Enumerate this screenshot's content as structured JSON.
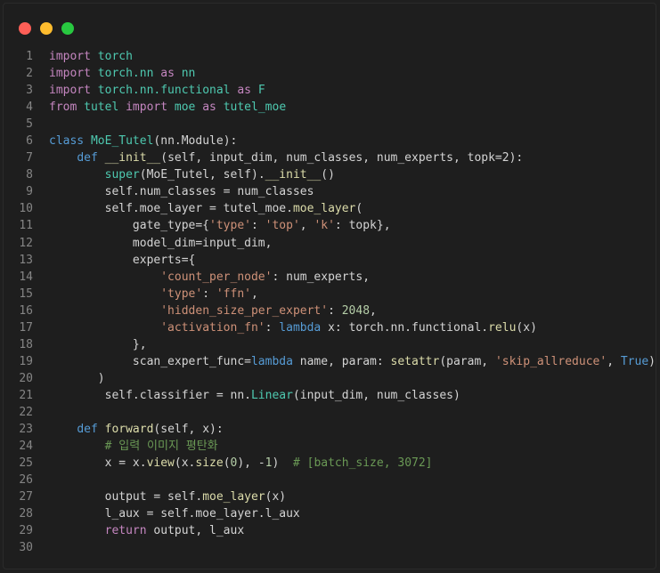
{
  "window": {
    "controls": {
      "close_color": "#ff5f57",
      "minimize_color": "#febc2e",
      "maximize_color": "#28c840"
    }
  },
  "code": {
    "language": "python",
    "lines": [
      [
        {
          "t": "import",
          "c": "ctl"
        },
        {
          "t": " torch",
          "c": "ty"
        }
      ],
      [
        {
          "t": "import",
          "c": "ctl"
        },
        {
          "t": " torch.nn ",
          "c": "ty"
        },
        {
          "t": "as",
          "c": "ctl"
        },
        {
          "t": " nn",
          "c": "ty"
        }
      ],
      [
        {
          "t": "import",
          "c": "ctl"
        },
        {
          "t": " torch.nn.functional ",
          "c": "ty"
        },
        {
          "t": "as",
          "c": "ctl"
        },
        {
          "t": " F",
          "c": "ty"
        }
      ],
      [
        {
          "t": "from",
          "c": "ctl"
        },
        {
          "t": " tutel ",
          "c": "ty"
        },
        {
          "t": "import",
          "c": "ctl"
        },
        {
          "t": " moe ",
          "c": "ty"
        },
        {
          "t": "as",
          "c": "ctl"
        },
        {
          "t": " tutel_moe",
          "c": "ty"
        }
      ],
      [],
      [
        {
          "t": "class",
          "c": "kw"
        },
        {
          "t": " MoE_Tutel",
          "c": "ty"
        },
        {
          "t": "(nn.Module):",
          "c": ""
        }
      ],
      [
        {
          "t": "    "
        },
        {
          "t": "def",
          "c": "kw"
        },
        {
          "t": " __init__",
          "c": "fn"
        },
        {
          "t": "(self, input_dim, num_classes, num_experts, topk=2):",
          "c": ""
        }
      ],
      [
        {
          "t": "        "
        },
        {
          "t": "super",
          "c": "ty"
        },
        {
          "t": "(MoE_Tutel, self).",
          "c": ""
        },
        {
          "t": "__init__",
          "c": "fn"
        },
        {
          "t": "()",
          "c": ""
        }
      ],
      [
        {
          "t": "        self.num_classes = num_classes",
          "c": ""
        }
      ],
      [
        {
          "t": "        self.moe_layer = tutel_moe.",
          "c": ""
        },
        {
          "t": "moe_layer",
          "c": "fn"
        },
        {
          "t": "(",
          "c": ""
        }
      ],
      [
        {
          "t": "            gate_type={",
          "c": ""
        },
        {
          "t": "'type'",
          "c": "st"
        },
        {
          "t": ": ",
          "c": ""
        },
        {
          "t": "'top'",
          "c": "st"
        },
        {
          "t": ", ",
          "c": ""
        },
        {
          "t": "'k'",
          "c": "st"
        },
        {
          "t": ": topk},",
          "c": ""
        }
      ],
      [
        {
          "t": "            model_dim=input_dim,",
          "c": ""
        }
      ],
      [
        {
          "t": "            experts={",
          "c": ""
        }
      ],
      [
        {
          "t": "                "
        },
        {
          "t": "'count_per_node'",
          "c": "st"
        },
        {
          "t": ": num_experts,",
          "c": ""
        }
      ],
      [
        {
          "t": "                "
        },
        {
          "t": "'type'",
          "c": "st"
        },
        {
          "t": ": ",
          "c": ""
        },
        {
          "t": "'ffn'",
          "c": "st"
        },
        {
          "t": ",",
          "c": ""
        }
      ],
      [
        {
          "t": "                "
        },
        {
          "t": "'hidden_size_per_expert'",
          "c": "st"
        },
        {
          "t": ": ",
          "c": ""
        },
        {
          "t": "2048",
          "c": "nu"
        },
        {
          "t": ",",
          "c": ""
        }
      ],
      [
        {
          "t": "                "
        },
        {
          "t": "'activation_fn'",
          "c": "st"
        },
        {
          "t": ": ",
          "c": ""
        },
        {
          "t": "lambda",
          "c": "kw"
        },
        {
          "t": " x: torch.nn.functional.",
          "c": ""
        },
        {
          "t": "relu",
          "c": "fn"
        },
        {
          "t": "(x)",
          "c": ""
        }
      ],
      [
        {
          "t": "            },",
          "c": ""
        }
      ],
      [
        {
          "t": "            scan_expert_func=",
          "c": ""
        },
        {
          "t": "lambda",
          "c": "kw"
        },
        {
          "t": " name, param: ",
          "c": ""
        },
        {
          "t": "setattr",
          "c": "fn"
        },
        {
          "t": "(param, ",
          "c": ""
        },
        {
          "t": "'skip_allreduce'",
          "c": "st"
        },
        {
          "t": ", ",
          "c": ""
        },
        {
          "t": "True",
          "c": "kw"
        },
        {
          "t": ")",
          "c": ""
        }
      ],
      [
        {
          "t": "       )",
          "c": ""
        }
      ],
      [
        {
          "t": "        self.classifier = nn.",
          "c": ""
        },
        {
          "t": "Linear",
          "c": "ty"
        },
        {
          "t": "(input_dim, num_classes)",
          "c": ""
        }
      ],
      [],
      [
        {
          "t": "    "
        },
        {
          "t": "def",
          "c": "kw"
        },
        {
          "t": " forward",
          "c": "fn"
        },
        {
          "t": "(self, x):",
          "c": ""
        }
      ],
      [
        {
          "t": "        "
        },
        {
          "t": "# 입력 이미지 평탄화",
          "c": "cm"
        }
      ],
      [
        {
          "t": "        x = x.",
          "c": ""
        },
        {
          "t": "view",
          "c": "fn"
        },
        {
          "t": "(x.",
          "c": ""
        },
        {
          "t": "size",
          "c": "fn"
        },
        {
          "t": "(",
          "c": ""
        },
        {
          "t": "0",
          "c": "nu"
        },
        {
          "t": "), -",
          "c": ""
        },
        {
          "t": "1",
          "c": "nu"
        },
        {
          "t": ")  ",
          "c": ""
        },
        {
          "t": "# [batch_size, 3072]",
          "c": "cm"
        }
      ],
      [],
      [
        {
          "t": "        output = self.",
          "c": ""
        },
        {
          "t": "moe_layer",
          "c": "fn"
        },
        {
          "t": "(x)",
          "c": ""
        }
      ],
      [
        {
          "t": "        l_aux = self.moe_layer.l_aux",
          "c": ""
        }
      ],
      [
        {
          "t": "        "
        },
        {
          "t": "return",
          "c": "ctl"
        },
        {
          "t": " output, l_aux",
          "c": ""
        }
      ],
      []
    ]
  }
}
